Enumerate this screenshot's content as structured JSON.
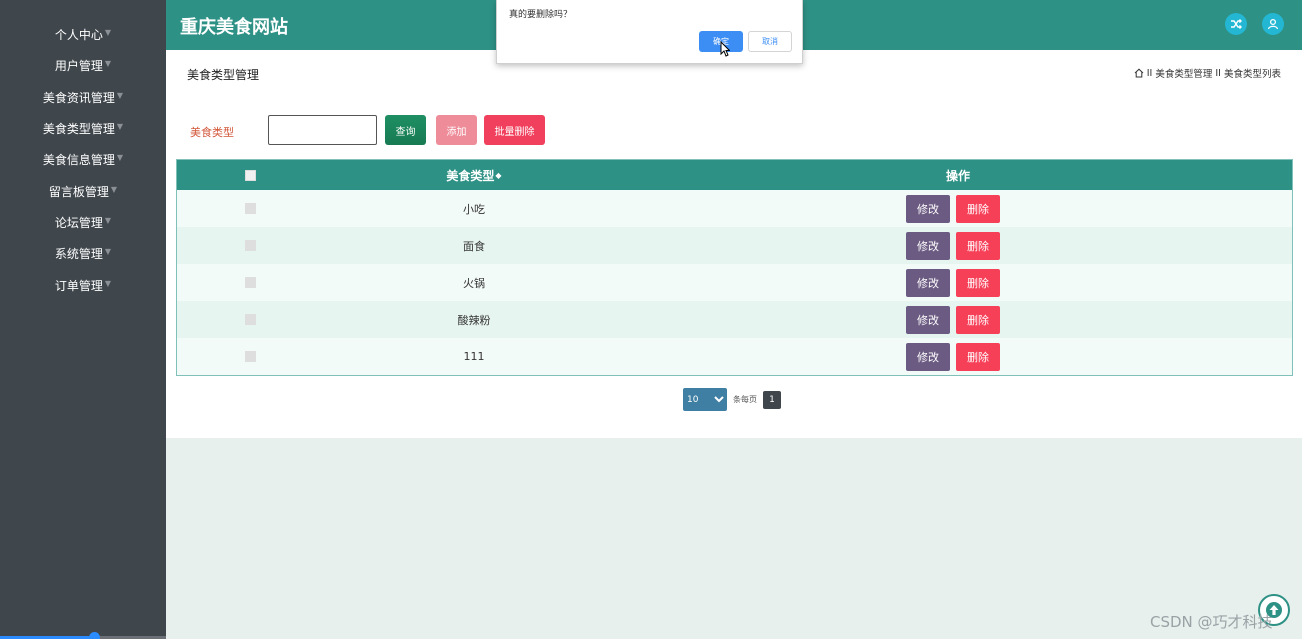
{
  "sidebar": {
    "items": [
      {
        "label": "个人中心"
      },
      {
        "label": "用户管理"
      },
      {
        "label": "美食资讯管理"
      },
      {
        "label": "美食类型管理"
      },
      {
        "label": "美食信息管理"
      },
      {
        "label": "留言板管理"
      },
      {
        "label": "论坛管理"
      },
      {
        "label": "系统管理"
      },
      {
        "label": "订单管理"
      }
    ]
  },
  "header": {
    "title": "重庆美食网站",
    "shuffle_icon": "shuffle-icon",
    "user_icon": "user-icon"
  },
  "page": {
    "title": "美食类型管理",
    "breadcrumb": [
      "美食类型管理",
      "美食类型列表"
    ],
    "breadcrumb_separator": "II"
  },
  "search": {
    "label": "美食类型",
    "value": "",
    "query_label": "查询",
    "add_label": "添加",
    "batch_delete_label": "批量删除"
  },
  "table": {
    "headers": {
      "name": "美食类型",
      "ops": "操作"
    },
    "edit_label": "修改",
    "delete_label": "删除",
    "rows": [
      {
        "name": "小吃"
      },
      {
        "name": "面食"
      },
      {
        "name": "火锅"
      },
      {
        "name": "酸辣粉"
      },
      {
        "name": "111"
      }
    ]
  },
  "pagination": {
    "page_size": "10",
    "per_page_label": "条每页",
    "current_page": "1"
  },
  "dialog": {
    "message": "真的要删除吗？",
    "ok_label": "确定",
    "cancel_label": "取消"
  },
  "watermark": "CSDN @巧才科技",
  "colors": {
    "header": "#2e9185",
    "sidebar": "#3f464c",
    "edit": "#6b5a82",
    "delete": "#f64058"
  }
}
